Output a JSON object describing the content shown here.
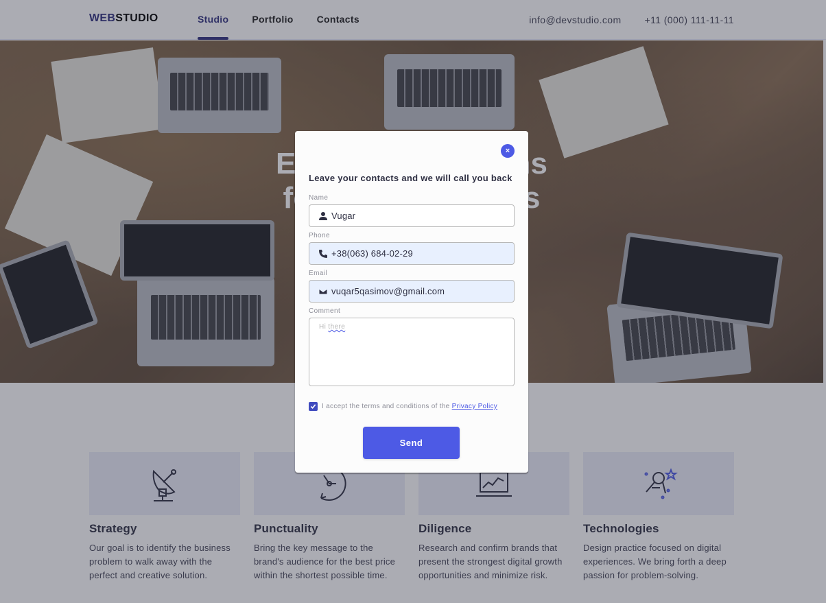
{
  "header": {
    "logo_part1": "Web",
    "logo_part2": "Studio",
    "nav": [
      {
        "label": "Studio",
        "active": true
      },
      {
        "label": "Portfolio",
        "active": false
      },
      {
        "label": "Contacts",
        "active": false
      }
    ],
    "email": "info@devstudio.com",
    "phone": "+11 (000) 111-11-11"
  },
  "hero": {
    "title_line1": "Effective Solutions",
    "title_line2": "for Your Business"
  },
  "features": [
    {
      "icon": "antenna-icon",
      "title": "Strategy",
      "text": "Our goal is to identify the business problem to walk away with the perfect and creative solution."
    },
    {
      "icon": "clock-icon",
      "title": "Punctuality",
      "text": "Bring the key message to the brand's audience for the best price within the shortest possible time."
    },
    {
      "icon": "diagram-icon",
      "title": "Diligence",
      "text": "Research and confirm brands that present the strongest digital growth opportunities and minimize risk."
    },
    {
      "icon": "astronaut-icon",
      "title": "Technologies",
      "text": "Design practice focused on digital experiences. We bring forth a deep passion for problem-solving."
    }
  ],
  "modal": {
    "close_symbol": "×",
    "title": "Leave your contacts and we will call you back",
    "fields": {
      "name": {
        "label": "Name",
        "value": "Vugar"
      },
      "phone": {
        "label": "Phone",
        "value": "+38(063) 684-02-29"
      },
      "email": {
        "label": "Email",
        "value": "vuqar5qasimov@gmail.com"
      },
      "comment": {
        "label": "Comment",
        "value_prefix": "Hi ",
        "value_suffix": "there"
      }
    },
    "checkbox_checked": true,
    "terms_text": "I accept the terms and conditions of the ",
    "policy_link": "Privacy Policy",
    "send_label": "Send"
  },
  "colors": {
    "accent": "#4d5ae5",
    "brand_dark": "#2f2f7e",
    "overlay": "rgba(46, 47, 66, 0.4)"
  }
}
